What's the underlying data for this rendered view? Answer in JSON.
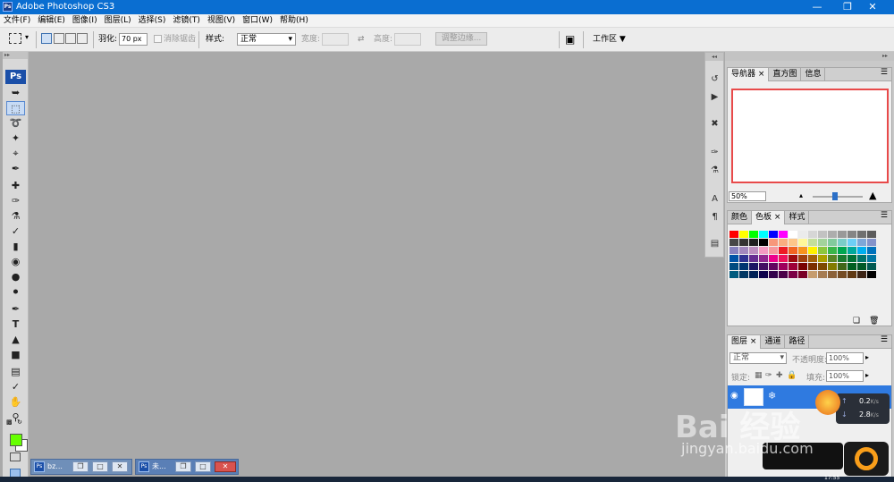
{
  "window": {
    "title": "Adobe Photoshop CS3",
    "icon_text": "Ps"
  },
  "menu": [
    "文件(F)",
    "编辑(E)",
    "图像(I)",
    "图层(L)",
    "选择(S)",
    "滤镜(T)",
    "视图(V)",
    "窗口(W)",
    "帮助(H)"
  ],
  "options": {
    "feather_label": "羽化:",
    "feather_value": "70 px",
    "antialias_label": "消除锯齿",
    "style_label": "样式:",
    "style_value": "正常",
    "width_label": "宽度:",
    "height_label": "高度:",
    "refine_button": "调整边缘...",
    "workspace_label": "工作区"
  },
  "toolbox": {
    "logo": "Ps"
  },
  "tasks": [
    {
      "label": "bz..."
    },
    {
      "label": "未..."
    }
  ],
  "navigator": {
    "tabs": [
      "导航器",
      "直方图",
      "信息"
    ],
    "zoom": "50%"
  },
  "color_panel": {
    "tabs": [
      "颜色",
      "色板",
      "样式"
    ]
  },
  "layers": {
    "tabs": [
      "图层",
      "通道",
      "路径"
    ],
    "blend": "正常",
    "opacity_label": "不透明度:",
    "opacity": "100%",
    "lock_label": "锁定:",
    "fill_label": "填充:",
    "fill": "100%"
  },
  "net": {
    "up": "0.2",
    "down": "2.8",
    "unit": "K/s"
  },
  "watermark": {
    "brand": "Bai 经验",
    "url": "jingyan.baidu.com"
  },
  "clock": "17:55",
  "colors": {
    "accent": "#0a6ed1",
    "fg_swatch": "#66ff00",
    "highlight": "#e84a4a"
  }
}
